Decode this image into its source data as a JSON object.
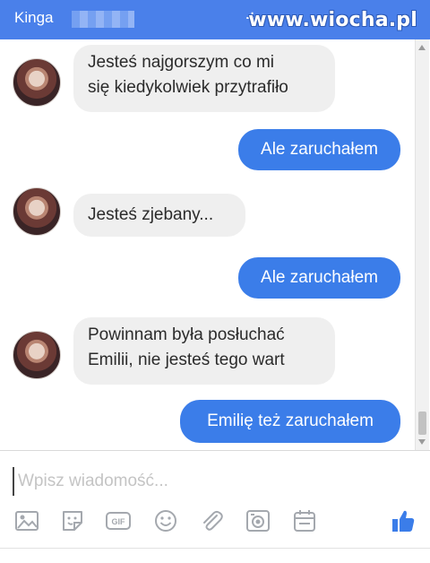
{
  "header": {
    "contact_name": "Kinga",
    "new_icon": "plus-icon",
    "settings_icon": "gear-icon",
    "close_icon": "close-icon",
    "watermark": "www.wiocha.pl"
  },
  "messages": [
    {
      "direction": "incoming",
      "text_line1": "Jesteś najgorszym co mi",
      "text_line2": "się kiedykolwiek przytrafiło"
    },
    {
      "direction": "outgoing",
      "text_line1": "Ale zaruchałem"
    },
    {
      "direction": "incoming",
      "text_line1": "Jesteś zjebany..."
    },
    {
      "direction": "outgoing",
      "text_line1": "Ale zaruchałem"
    },
    {
      "direction": "incoming",
      "text_line1": "Powinnam była posłuchać",
      "text_line2": "Emilii, nie jesteś tego wart"
    },
    {
      "direction": "outgoing",
      "text_line1": "Emilię też zaruchałem"
    }
  ],
  "composer": {
    "placeholder": "Wpisz wiadomość...",
    "tools": [
      "image-icon",
      "sticker-icon",
      "gif-icon",
      "emoji-icon",
      "attachment-icon",
      "camera-icon",
      "calendar-icon",
      "like-icon"
    ],
    "gif_label": "GIF"
  },
  "colors": {
    "header": "#4a80ea",
    "outgoing_bubble": "#3b7de9",
    "incoming_bubble": "#efefef",
    "tool_icons": "#a4a8ae",
    "like_icon": "#3b7de9"
  }
}
